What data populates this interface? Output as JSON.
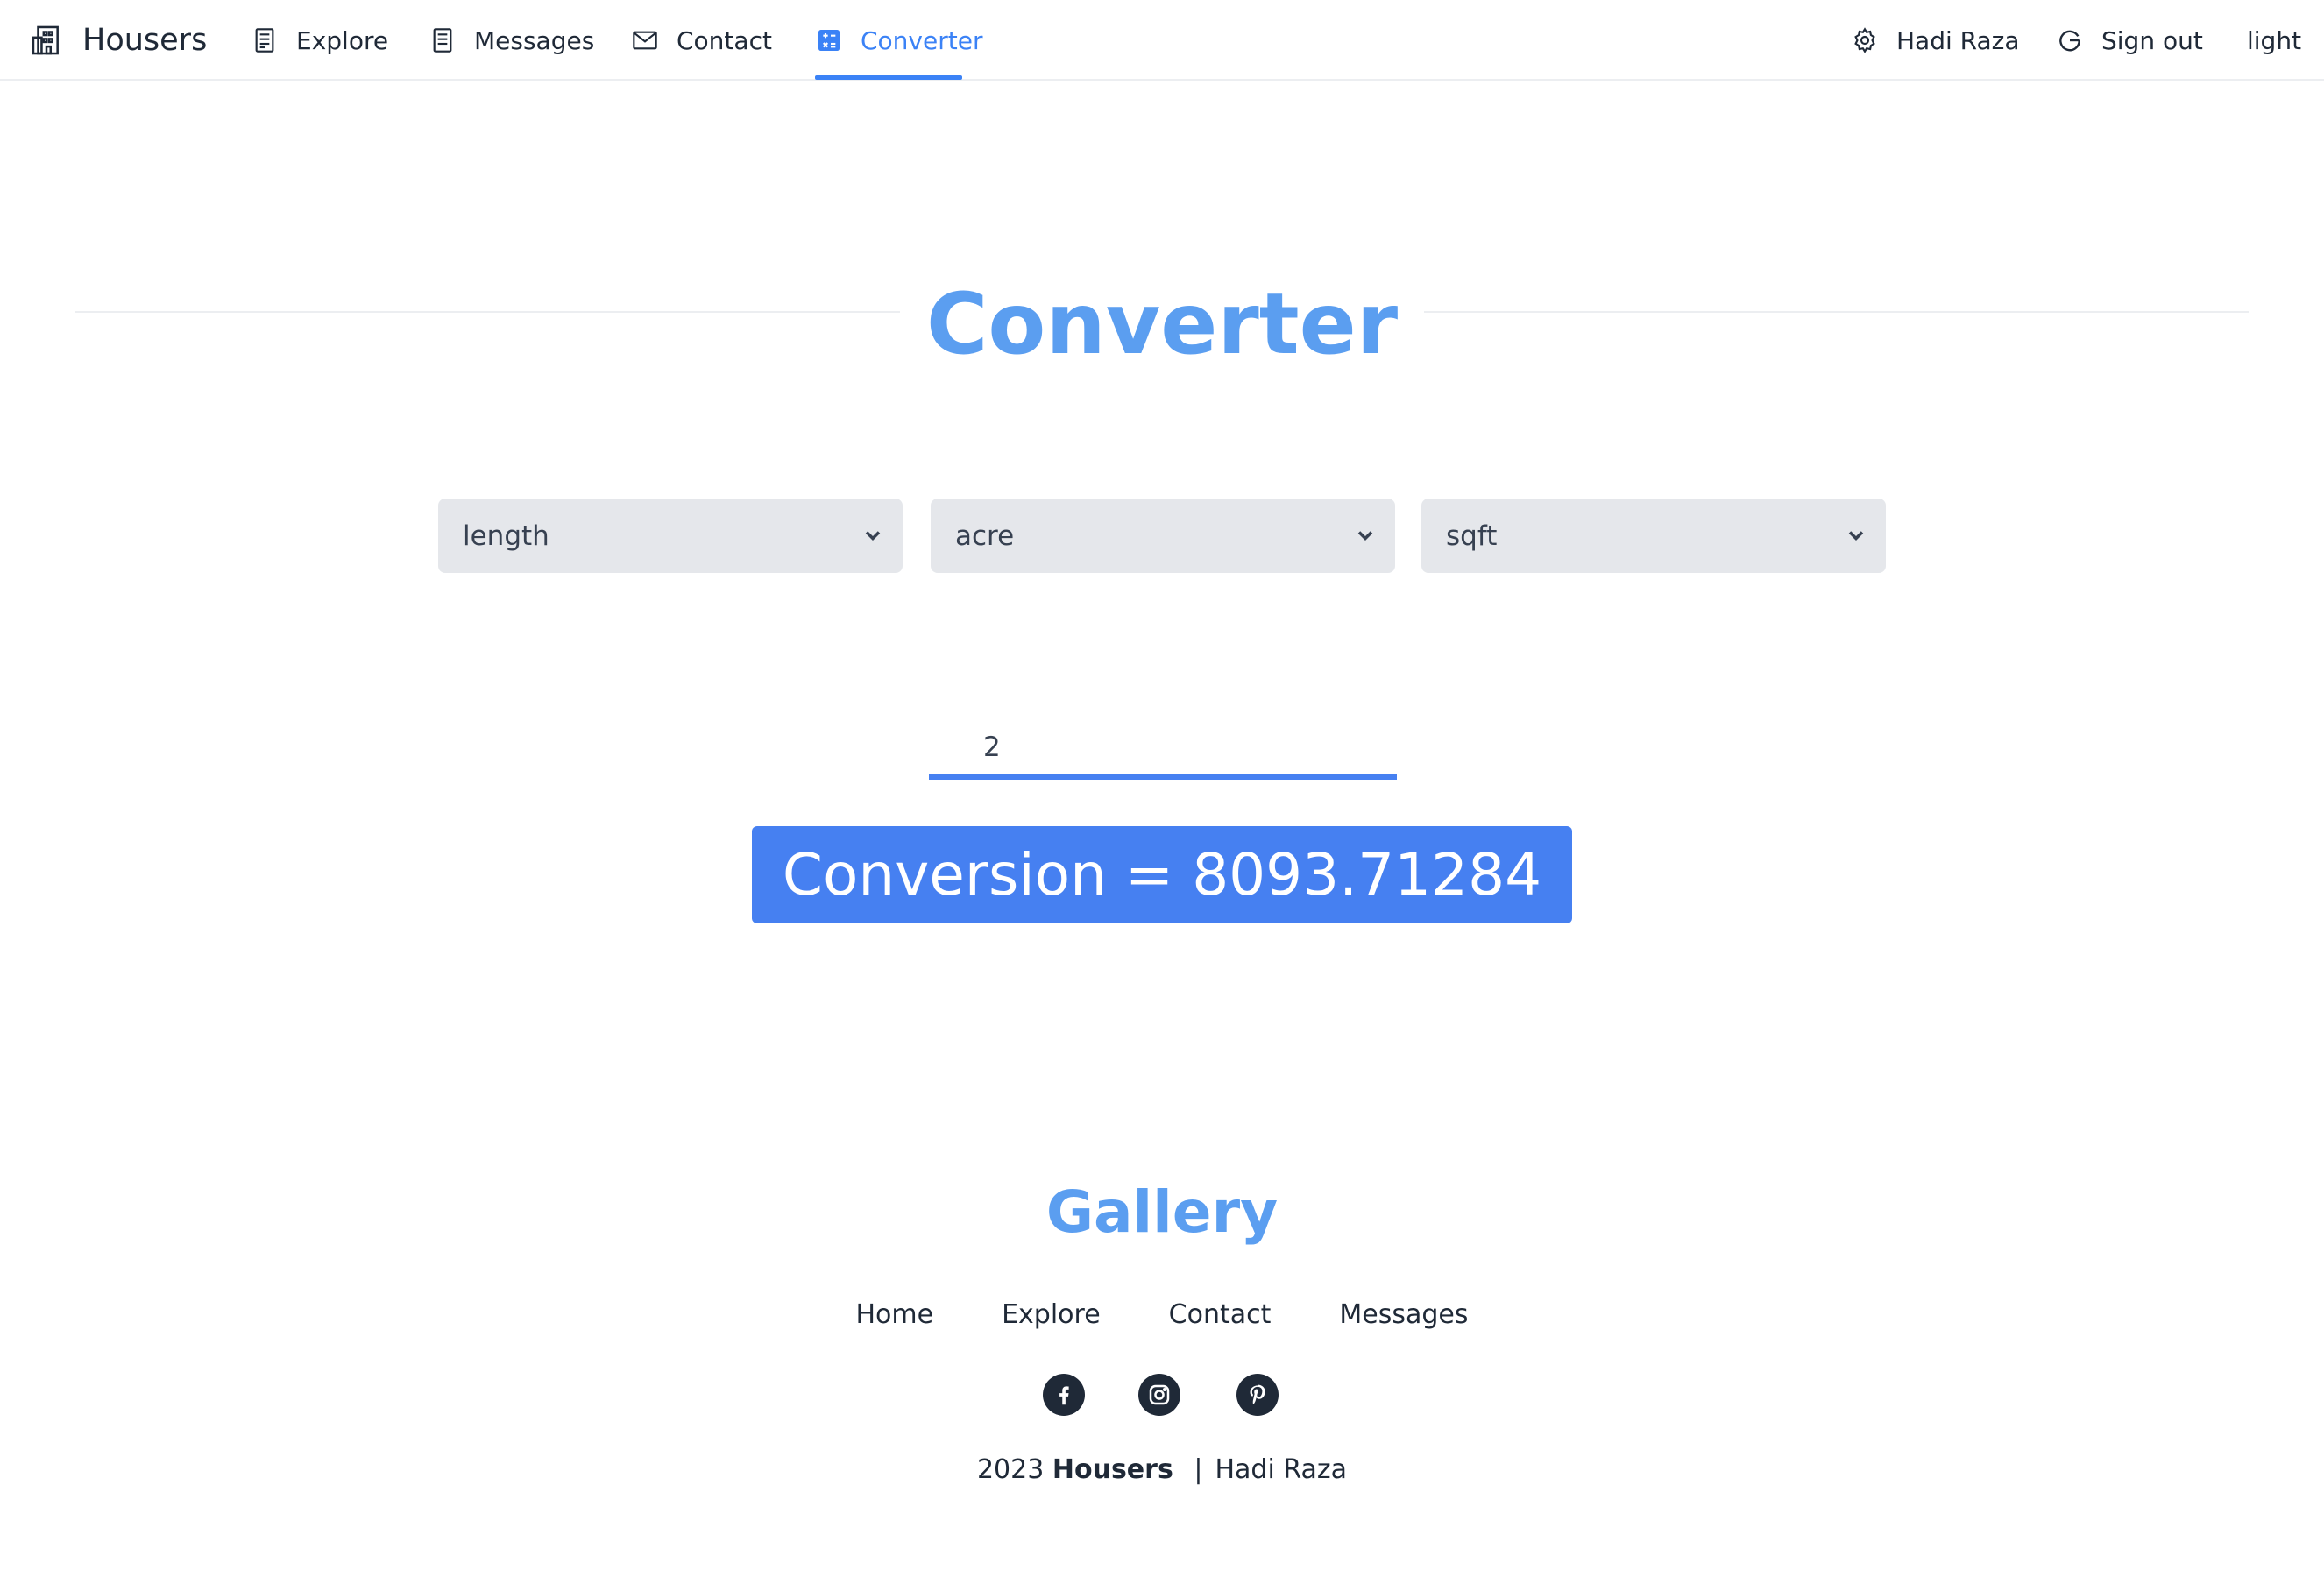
{
  "nav": {
    "brand": "Housers",
    "items": [
      {
        "label": "Explore"
      },
      {
        "label": "Messages"
      },
      {
        "label": "Contact"
      },
      {
        "label": "Converter"
      }
    ],
    "user": "Hadi Raza",
    "signout": "Sign out",
    "theme": "light"
  },
  "page": {
    "title": "Converter"
  },
  "converter": {
    "category": "length",
    "from_unit": "acre",
    "to_unit": "sqft",
    "value": "2",
    "result": "Conversion = 8093.71284"
  },
  "footer": {
    "title": "Gallery",
    "links": [
      "Home",
      "Explore",
      "Contact",
      "Messages"
    ],
    "year": "2023",
    "brand": "Housers",
    "separator": "|",
    "author": "Hadi Raza"
  },
  "colors": {
    "accent": "#3b82f6",
    "button": "#4680f1",
    "title": "#5b9ef0",
    "text": "#1f2937"
  }
}
